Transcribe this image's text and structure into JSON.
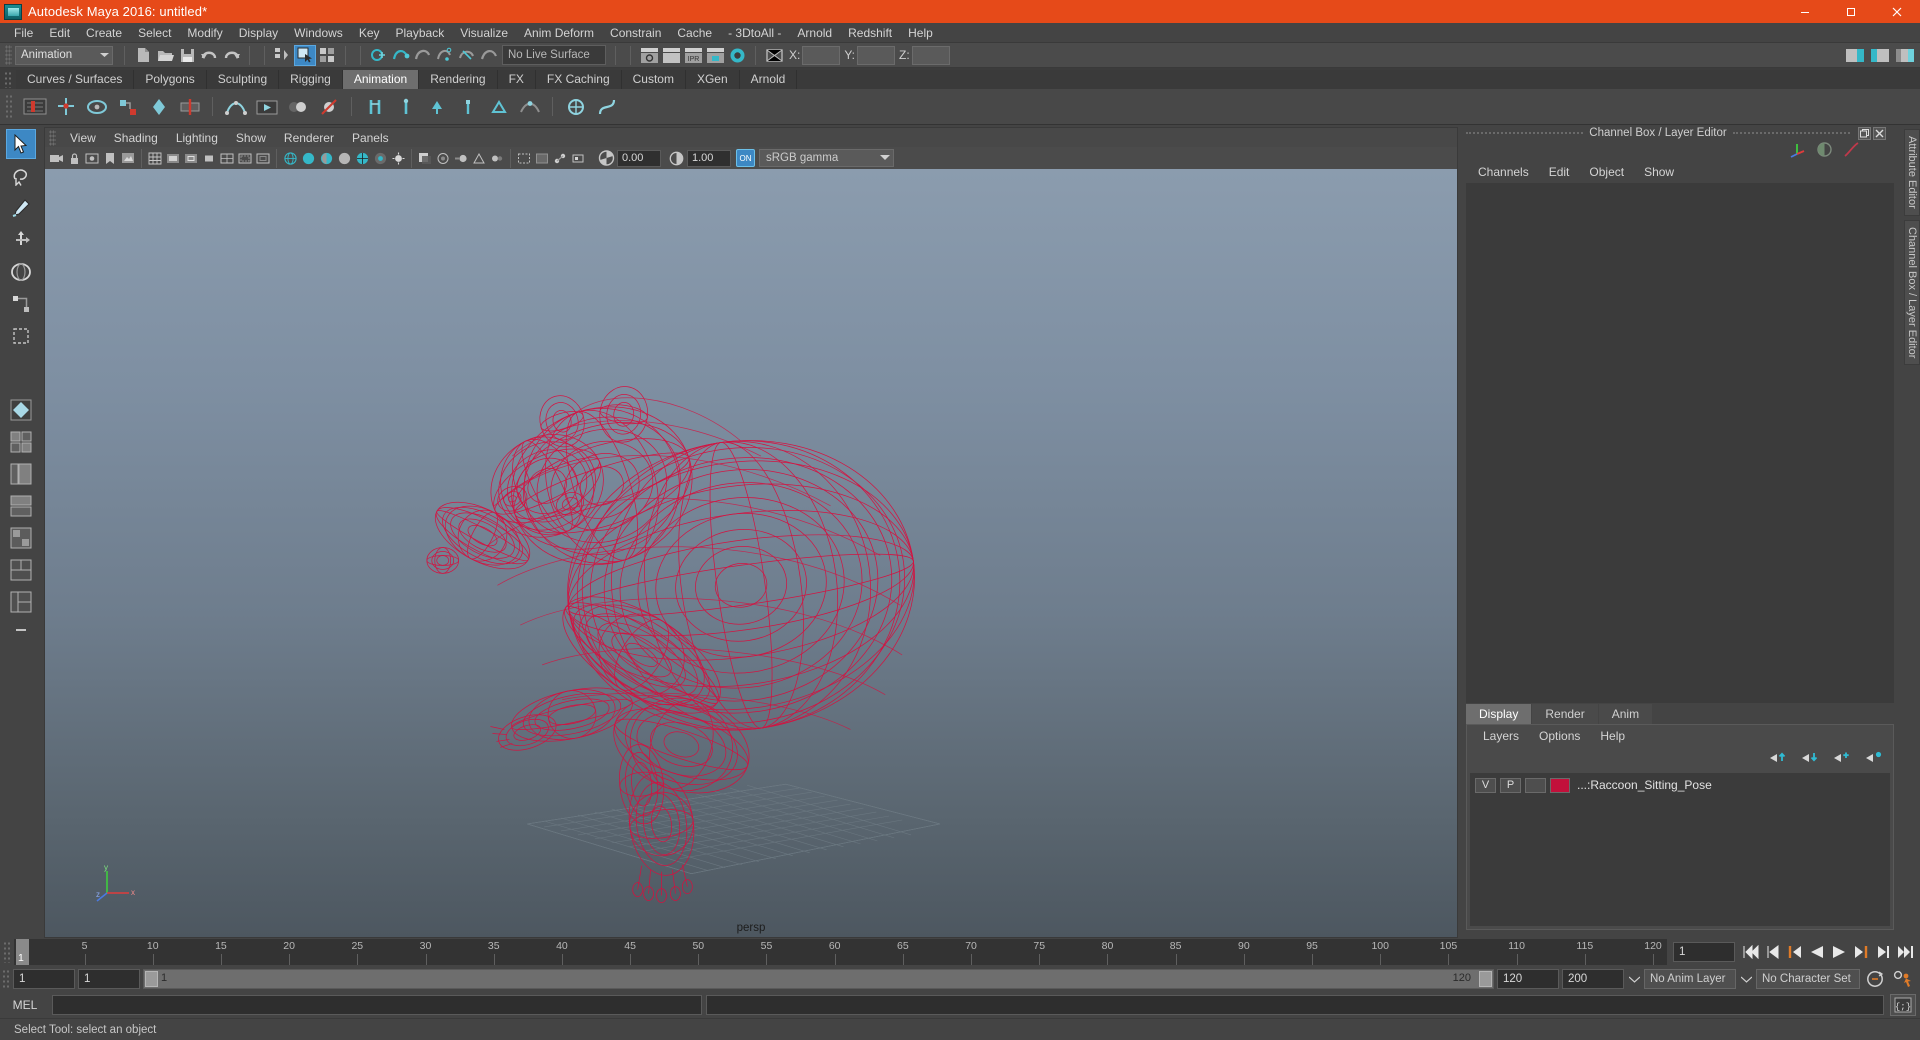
{
  "window": {
    "title": "Autodesk Maya 2016: untitled*",
    "app_icon": "maya-logo-icon",
    "minimize": "minimize-icon",
    "maximize": "maximize-icon",
    "close": "close-icon",
    "titlebar_color": "#e64a19"
  },
  "menubar": {
    "items": [
      "File",
      "Edit",
      "Create",
      "Select",
      "Modify",
      "Display",
      "Windows",
      "Key",
      "Playback",
      "Visualize",
      "Anim Deform",
      "Constrain",
      "Cache",
      "- 3DtoAll -",
      "Arnold",
      "Redshift",
      "Help"
    ]
  },
  "statusline": {
    "menu_set": "Animation",
    "live_surface": "No Live Surface",
    "x_label": "X:",
    "y_label": "Y:",
    "z_label": "Z:",
    "x_value": "",
    "y_value": "",
    "z_value": "",
    "icons": [
      "new-scene-icon",
      "open-scene-icon",
      "save-scene-icon",
      "undo-icon",
      "redo-icon",
      "select-by-hierarchy-icon",
      "select-by-object-icon",
      "select-by-component-icon",
      "snap-to-grid-icon",
      "snap-to-curve-icon",
      "snap-to-point-icon",
      "snap-to-projected-center-icon",
      "snap-to-view-plane-icon",
      "make-live-icon",
      "show-manipulator-icon",
      "render-view-icon",
      "render-current-frame-icon",
      "ipr-render-icon",
      "render-settings-icon",
      "hypershade-icon",
      "render-sequence-icon"
    ],
    "right_icons": [
      "sidebar-attribute-editor-icon",
      "sidebar-tool-settings-icon",
      "sidebar-channel-box-icon"
    ]
  },
  "shelf": {
    "tabs": [
      "Curves / Surfaces",
      "Polygons",
      "Sculpting",
      "Rigging",
      "Animation",
      "Rendering",
      "FX",
      "FX Caching",
      "Custom",
      "XGen",
      "Arnold"
    ],
    "active_tab": "Animation",
    "icons": [
      "set-key-icon",
      "set-key-translate-icon",
      "set-key-rotate-icon",
      "set-key-scale-icon",
      "breakdown-key-icon",
      "mute-key-icon",
      "ikfk-key-icon",
      "bake-channel-icon",
      "playblast-icon",
      "ghost-selected-icon",
      "unghost-icon",
      "constrain-parent-icon",
      "constrain-point-icon",
      "constrain-orient-icon",
      "constrain-scale-icon",
      "constrain-aim-icon",
      "motion-path-icon",
      "create-deformer-icon",
      "nonlinear-deformer-icon"
    ]
  },
  "toolbox": {
    "items": [
      "select-tool-icon",
      "lasso-select-tool-icon",
      "paint-select-tool-icon",
      "move-tool-icon",
      "rotate-tool-icon",
      "scale-tool-icon",
      "last-tool-icon",
      "layout-single-icon",
      "layout-four-view-icon",
      "layout-outliner-persp-icon",
      "layout-persp-graph-icon",
      "layout-hypershade-persp-icon",
      "layout-persp-graph-outliner-icon",
      "layout-three-pane-icon",
      "layout-saved-icon"
    ],
    "active": "select-tool-icon"
  },
  "viewport": {
    "menus": [
      "View",
      "Shading",
      "Lighting",
      "Show",
      "Renderer",
      "Panels"
    ],
    "camera_label": "persp",
    "exposure_value": "0.00",
    "gamma_value": "1.00",
    "color_management_on": "ON",
    "color_profile": "sRGB gamma",
    "toolbar_icons": [
      "select-camera-icon",
      "lock-camera-icon",
      "camera-attributes-icon",
      "bookmarks-icon",
      "image-plane-icon",
      "two-d-pan-zoom-icon",
      "grid-toggle-icon",
      "film-gate-icon",
      "resolution-gate-icon",
      "gate-mask-icon",
      "field-chart-icon",
      "safe-action-icon",
      "safe-title-icon",
      "wireframe-icon",
      "smooth-shade-all-icon",
      "smooth-shade-selected-icon",
      "use-default-material-icon",
      "shaded-wireframe-icon",
      "textured-icon",
      "use-all-lights-icon",
      "shadows-icon",
      "screen-space-ao-icon",
      "motion-blur-icon",
      "multisample-aa-icon",
      "depth-of-field-icon",
      "isolate-select-icon",
      "xray-icon",
      "xray-joints-icon",
      "xray-active-components-icon",
      "exposure-icon",
      "gamma-icon",
      "color-management-toggle-icon"
    ],
    "model_description": "Red wireframe raccoon sitting pose on ground grid",
    "wireframe_color": "#d6103f",
    "bg_top": "#8b9cae",
    "bg_bottom": "#4d5760"
  },
  "channel_box_panel": {
    "title": "Channel Box / Layer Editor",
    "undock_icon": "undock-icon",
    "close_icon": "close-panel-icon",
    "header_icons": [
      "axis-gizmo-icon",
      "sphere-shading-icon",
      "curve-icon"
    ],
    "menus": [
      "Channels",
      "Edit",
      "Object",
      "Show"
    ]
  },
  "layer_editor": {
    "tabs": [
      "Display",
      "Render",
      "Anim"
    ],
    "active_tab": "Display",
    "menus": [
      "Layers",
      "Options",
      "Help"
    ],
    "buttons": [
      "move-layer-up-icon",
      "move-layer-down-icon",
      "new-layer-icon",
      "new-layer-from-selected-icon"
    ],
    "layers": [
      {
        "visibility": "V",
        "playback": "P",
        "state": "",
        "color": "#c2103b",
        "name": "...:Raccoon_Sitting_Pose"
      }
    ]
  },
  "side_tabs": [
    "Attribute Editor",
    "Channel Box / Layer Editor"
  ],
  "timeline": {
    "start": 1,
    "end": 120,
    "current_frame": "1",
    "tick_labels": [
      5,
      10,
      15,
      20,
      25,
      30,
      35,
      40,
      45,
      50,
      55,
      60,
      65,
      70,
      75,
      80,
      85,
      90,
      95,
      100,
      105,
      110,
      115,
      120
    ],
    "playhead_label": "1",
    "playback_buttons": [
      "go-to-start-icon",
      "step-back-keyframe-icon",
      "step-back-frame-icon",
      "play-backwards-icon",
      "play-forwards-icon",
      "step-forward-frame-icon",
      "step-forward-keyframe-icon",
      "go-to-end-icon"
    ]
  },
  "range_slider": {
    "anim_start": "1",
    "range_start": "1",
    "bar_start_label": "1",
    "bar_end_label": "120",
    "range_end": "120",
    "anim_end": "200",
    "anim_layer": "No Anim Layer",
    "character_set": "No Character Set",
    "auto_key_icon": "auto-keyframe-icon",
    "anim_prefs_icon": "animation-preferences-icon"
  },
  "command_line": {
    "language_label": "MEL",
    "input_value": "",
    "output_value": "",
    "script_editor_icon": "script-editor-icon"
  },
  "help_line": {
    "message": "Select Tool: select an object"
  }
}
